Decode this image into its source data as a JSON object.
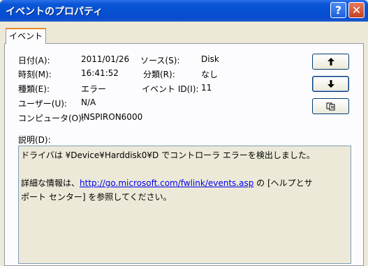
{
  "window": {
    "title": "イベントのプロパティ",
    "help_glyph": "?",
    "close_glyph": "✕"
  },
  "tab": {
    "label": "イベント"
  },
  "fields": {
    "date": {
      "label": "日付(A):",
      "value": "2011/01/26"
    },
    "time": {
      "label": "時刻(M):",
      "value": "16:41:52"
    },
    "type": {
      "label": "種類(E):",
      "value": "エラー"
    },
    "user": {
      "label": "ユーザー(U):",
      "value": "N/A"
    },
    "computer": {
      "label": "コンピュータ(O):",
      "value": "INSPIRON6000"
    },
    "source": {
      "label": "ソース(S):",
      "value": "Disk"
    },
    "category": {
      "label": "分類(R):",
      "value": "なし"
    },
    "event_id": {
      "label": "イベント ID(I):",
      "value": "11"
    }
  },
  "description": {
    "label": "説明(D):",
    "line1": "ドライバは ¥Device¥Harddisk0¥D でコントローラ エラーを検出しました。",
    "line2_prefix": "詳細な情報は、",
    "link": "http://go.microsoft.com/fwlink/events.asp",
    "line2_suffix": " の [ヘルプとサ",
    "line3": "ポート センター] を参照してください。"
  },
  "buttons": {
    "up_glyph": "🠕",
    "down_glyph": "🠗",
    "copy_icon": "copy-icon"
  }
}
